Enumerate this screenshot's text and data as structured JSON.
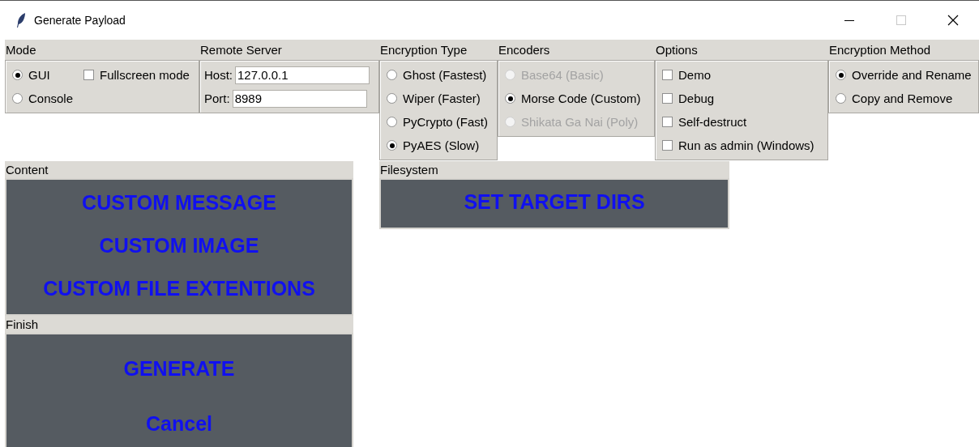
{
  "window": {
    "title": "Generate Payload"
  },
  "mode": {
    "label": "Mode",
    "options": [
      {
        "label": "GUI",
        "selected": true
      },
      {
        "label": "Console",
        "selected": false
      }
    ],
    "fullscreen": {
      "label": "Fullscreen mode",
      "checked": false
    }
  },
  "remote_server": {
    "label": "Remote Server",
    "fields": [
      {
        "label": "Host:",
        "value": "127.0.0.1"
      },
      {
        "label": "Port:",
        "value": "8989"
      }
    ]
  },
  "encryption_type": {
    "label": "Encryption Type",
    "options": [
      {
        "label": "Ghost (Fastest)",
        "selected": false
      },
      {
        "label": "Wiper (Faster)",
        "selected": false
      },
      {
        "label": "PyCrypto (Fast)",
        "selected": false
      },
      {
        "label": "PyAES (Slow)",
        "selected": true
      }
    ]
  },
  "encoders": {
    "label": "Encoders",
    "options": [
      {
        "label": "Base64 (Basic)",
        "selected": false,
        "disabled": true
      },
      {
        "label": "Morse Code (Custom)",
        "selected": true,
        "disabled": false
      },
      {
        "label": "Shikata Ga Nai (Poly)",
        "selected": false,
        "disabled": true
      }
    ]
  },
  "options": {
    "label": "Options",
    "items": [
      {
        "label": "Demo",
        "checked": false
      },
      {
        "label": "Debug",
        "checked": false
      },
      {
        "label": "Self-destruct",
        "checked": false
      },
      {
        "label": "Run as admin (Windows)",
        "checked": false
      }
    ]
  },
  "encryption_method": {
    "label": "Encryption Method",
    "options": [
      {
        "label": "Override and Rename",
        "selected": true
      },
      {
        "label": "Copy and Remove",
        "selected": false
      }
    ]
  },
  "content": {
    "label": "Content",
    "buttons": [
      "CUSTOM MESSAGE",
      "CUSTOM IMAGE",
      "CUSTOM FILE EXTENTIONS"
    ]
  },
  "filesystem": {
    "label": "Filesystem",
    "buttons": [
      "SET TARGET DIRS"
    ]
  },
  "finish": {
    "label": "Finish",
    "buttons": [
      "GENERATE",
      "Cancel"
    ]
  }
}
